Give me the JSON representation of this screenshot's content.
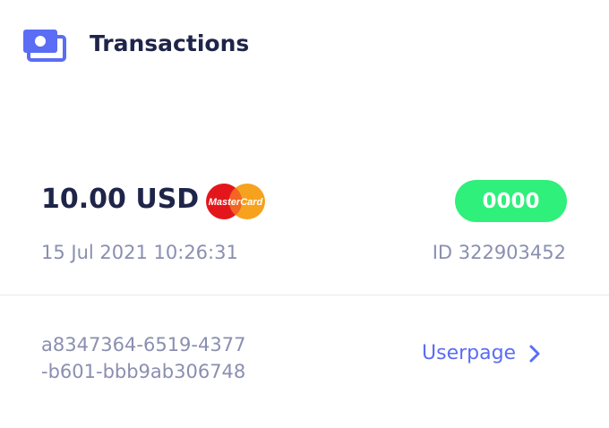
{
  "header": {
    "title": "Transactions",
    "icon": "cash-icon",
    "accent_color": "#5b6cf5"
  },
  "transaction": {
    "amount": "10.00 USD",
    "card_brand": "MasterCard",
    "card_icon": "mastercard-logo",
    "status_code": "0000",
    "status_color": "#2ef07a",
    "datetime": "15 Jul 2021 10:26:31",
    "id_label": "ID 322903452",
    "uuid_line1": "a8347364-6519-4377",
    "uuid_line2": "-b601-bbb9ab306748",
    "userpage_label": "Userpage",
    "userpage_icon": "chevron-right-icon"
  }
}
